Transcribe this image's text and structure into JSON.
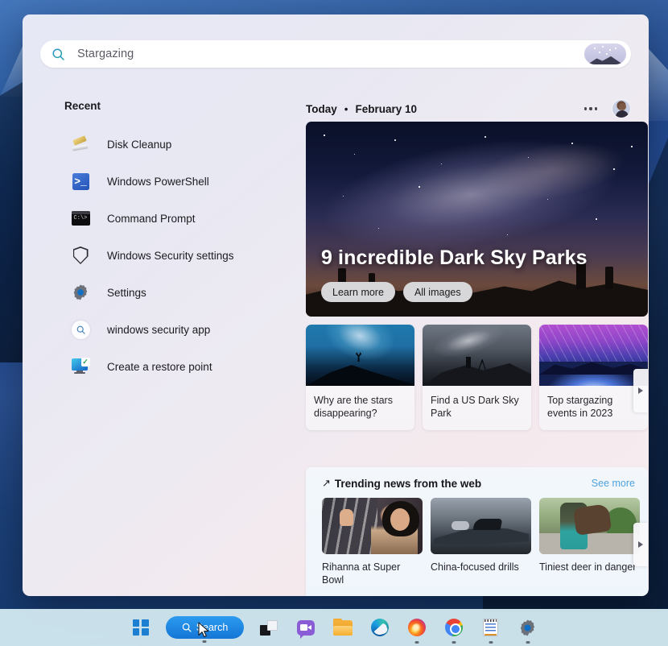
{
  "search": {
    "placeholder": "Stargazing",
    "icon": "search-icon",
    "thumbnail": "stargazing-thumbnail"
  },
  "sidebar": {
    "heading": "Recent",
    "items": [
      {
        "label": "Disk Cleanup",
        "icon": "disk-cleanup-icon"
      },
      {
        "label": "Windows PowerShell",
        "icon": "powershell-icon"
      },
      {
        "label": "Command Prompt",
        "icon": "command-prompt-icon"
      },
      {
        "label": "Windows Security settings",
        "icon": "shield-icon"
      },
      {
        "label": "Settings",
        "icon": "gear-icon"
      },
      {
        "label": "windows security app",
        "icon": "search-icon"
      },
      {
        "label": "Create a restore point",
        "icon": "restore-point-icon"
      }
    ]
  },
  "content": {
    "today_label": "Today",
    "separator": "•",
    "date": "February 10",
    "more_button": "more-options-icon",
    "avatar": "user-avatar",
    "hero": {
      "title": "9 incredible Dark Sky Parks",
      "primary_button": "Learn more",
      "secondary_button": "All images"
    },
    "cards": [
      {
        "title": "Why are the stars disappearing?"
      },
      {
        "title": "Find a US Dark Sky Park"
      },
      {
        "title": "Top stargazing events in 2023"
      }
    ],
    "trending": {
      "icon": "↗",
      "title": "Trending news from the web",
      "see_more": "See more",
      "items": [
        {
          "title": "Rihanna at Super Bowl"
        },
        {
          "title": "China-focused drills"
        },
        {
          "title": "Tiniest deer in danger"
        }
      ]
    }
  },
  "taskbar": {
    "items": [
      {
        "name": "start-button",
        "label": "Start"
      },
      {
        "name": "search-button",
        "label": "Search"
      },
      {
        "name": "task-view-button",
        "label": "Task View"
      },
      {
        "name": "chat-button",
        "label": "Chat"
      },
      {
        "name": "file-explorer-button",
        "label": "File Explorer"
      },
      {
        "name": "edge-button",
        "label": "Microsoft Edge"
      },
      {
        "name": "firefox-button",
        "label": "Firefox"
      },
      {
        "name": "chrome-button",
        "label": "Google Chrome"
      },
      {
        "name": "notepad-button",
        "label": "Notepad"
      },
      {
        "name": "settings-button",
        "label": "Settings"
      }
    ],
    "search_label": "Search"
  },
  "colors": {
    "accent": "#1476d6",
    "link": "#4ea3dd",
    "panel_bg": "#e9e9f3"
  }
}
